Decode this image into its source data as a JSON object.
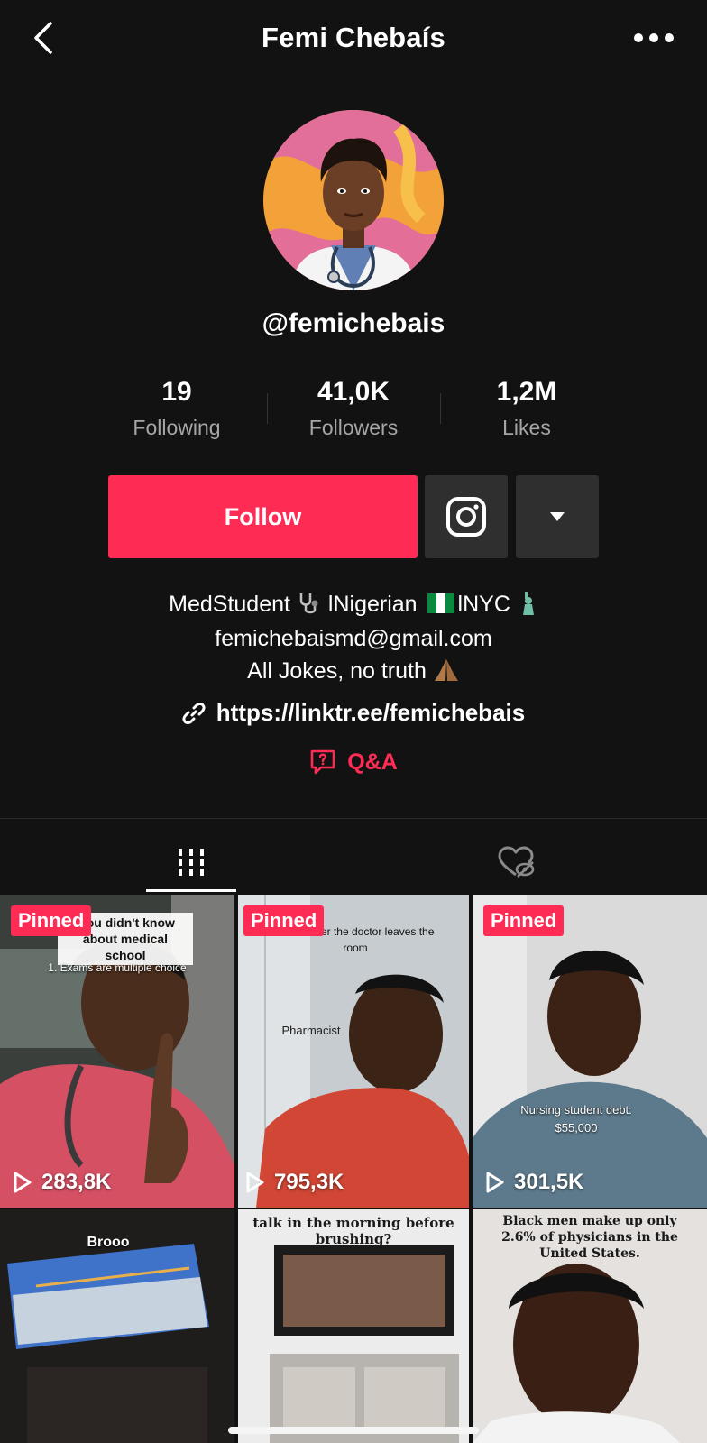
{
  "header": {
    "title": "Femi Chebaís"
  },
  "profile": {
    "username": "@femichebais"
  },
  "stats": [
    {
      "value": "19",
      "label": "Following"
    },
    {
      "value": "41,0K",
      "label": "Followers"
    },
    {
      "value": "1,2M",
      "label": "Likes"
    }
  ],
  "actions": {
    "follow_label": "Follow"
  },
  "bio": {
    "line1_a": "MedStudent",
    "line1_b": "lNigerian",
    "line1_c": "lNYC",
    "line2": "femichebaismd@gmail.com",
    "line3": "All Jokes, no truth"
  },
  "link": {
    "url": "https://linktr.ee/femichebais"
  },
  "qa": {
    "label": "Q&A"
  },
  "videos": [
    {
      "pinned": "Pinned",
      "views": "283,8K",
      "caption": "...ou didn't know about medical school",
      "caption2": "1. Exams are multiple choice"
    },
    {
      "pinned": "Pinned",
      "views": "795,3K",
      "caption": "...s on after the doctor leaves the room",
      "caption2": "Pharmacist"
    },
    {
      "pinned": "Pinned",
      "views": "301,5K",
      "caption": "Nursing student debt:",
      "caption2": "$55,000"
    },
    {
      "caption": "Brooo"
    },
    {
      "caption": "talk in the morning before brushing?"
    },
    {
      "caption": "Black men make up only 2.6% of physicians in the United States."
    }
  ],
  "colors": {
    "accent": "#fe2c55",
    "background": "#121212",
    "secondary_button": "#2f2f2f",
    "muted_text": "#a6a6a6"
  },
  "icons": {
    "back": "chevron-left-icon",
    "more": "more-dots-icon",
    "instagram": "instagram-icon",
    "dropdown": "caret-down-icon",
    "link": "link-icon",
    "qa": "qa-icon",
    "videos_tab": "grid-icon",
    "liked_tab": "liked-hidden-icon",
    "play": "play-icon"
  }
}
